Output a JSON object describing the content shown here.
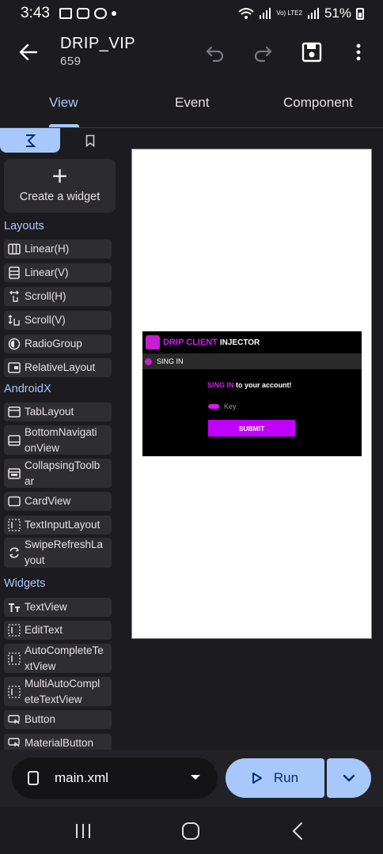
{
  "status_bar": {
    "time": "3:43",
    "battery": "51%",
    "network": "Vo) LTE2"
  },
  "app_bar": {
    "title": "DRIP_VIP",
    "subtitle": "659"
  },
  "tabs": [
    {
      "label": "View"
    },
    {
      "label": "Event"
    },
    {
      "label": "Component"
    }
  ],
  "palette": {
    "create_label": "Create a widget",
    "layouts_header": "Layouts",
    "layouts": [
      "Linear(H)",
      "Linear(V)",
      "Scroll(H)",
      "Scroll(V)",
      "RadioGroup",
      "RelativeLayout"
    ],
    "androidx_header": "AndroidX",
    "androidx": [
      "TabLayout",
      "BottomNavigati onView",
      "CollapsingToolb ar",
      "CardView",
      "TextInputLayout",
      "SwipeRefreshLa yout"
    ],
    "widgets_header": "Widgets",
    "widgets": [
      "TextView",
      "EditText",
      "AutoCompleteTe xtView",
      "MultiAutoCompl eteTextView",
      "Button",
      "MaterialButton"
    ]
  },
  "preview": {
    "brand": "DRIP CLIENT",
    "brand_suffix": "INJECTOR",
    "bar_label": "SING IN",
    "sing_in_highlight": "SING IN",
    "sing_in_rest": " to your account!",
    "key_hint": "Key",
    "submit_label": "SUBMIT"
  },
  "bottom": {
    "file_name": "main.xml",
    "run_label": "Run"
  },
  "colors": {
    "accent": "#a8c7fa",
    "brand": "#d21cf0",
    "submit": "#c200ff",
    "background": "#1c1b1f"
  }
}
